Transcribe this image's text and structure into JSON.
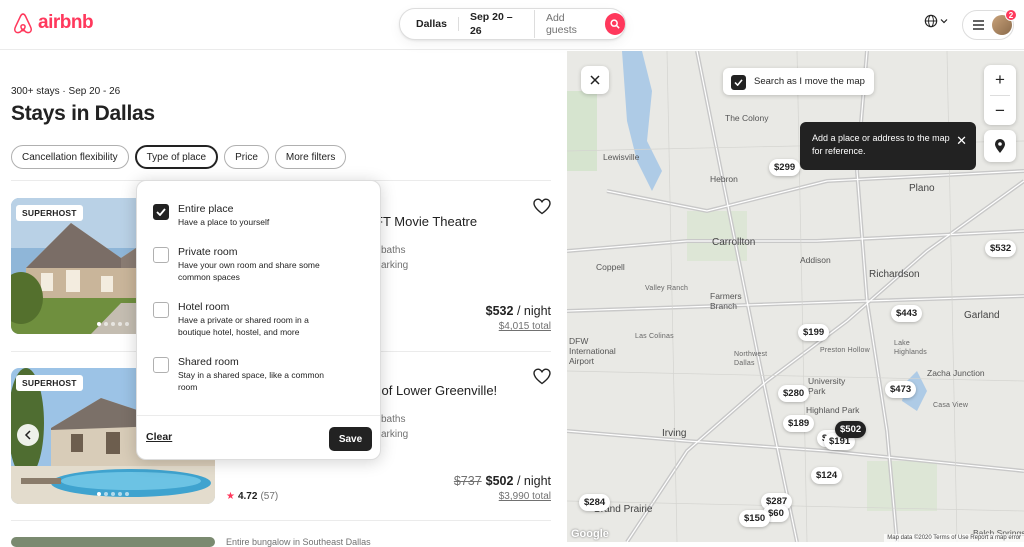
{
  "header": {
    "logo_text": "airbnb",
    "brand_color": "#ff385c",
    "search": {
      "location": "Dallas",
      "dates": "Sep 20 – 26",
      "guests_placeholder": "Add guests"
    },
    "notification_count": "2"
  },
  "listing": {
    "summary": "300+ stays · Sep 20 - 26",
    "title": "Stays in Dallas",
    "filters": [
      "Cancellation flexibility",
      "Type of place",
      "Price",
      "More filters"
    ]
  },
  "cards": [
    {
      "badge": "SUPERHOST",
      "title_partial": "FT Movie Theatre",
      "sub1": "baths",
      "sub2": "arking",
      "price": "$532",
      "per": " / night",
      "total": "$4,015 total"
    },
    {
      "badge": "SUPERHOST",
      "title_partial": "rt of Lower Greenville!",
      "sub1": "baths",
      "sub2": "arking",
      "old_price": "$737",
      "price": "$502",
      "per": " / night",
      "total": "$3,990 total",
      "rating": "4.72",
      "reviews": "(57)"
    },
    {
      "title_partial": "Entire bungalow in Southeast Dallas"
    }
  ],
  "type_of_place": {
    "options": [
      {
        "title": "Entire place",
        "desc": "Have a place to yourself",
        "checked": true
      },
      {
        "title": "Private room",
        "desc": "Have your own room and share some common spaces",
        "checked": false
      },
      {
        "title": "Hotel room",
        "desc": "Have a private or shared room in a boutique hotel, hostel, and more",
        "checked": false
      },
      {
        "title": "Shared room",
        "desc": "Stay in a shared space, like a common room",
        "checked": false
      }
    ],
    "clear_label": "Clear",
    "save_label": "Save"
  },
  "map": {
    "search_as_move": "Search as I move the map",
    "tooltip": "Add a place or address to the map for reference.",
    "zoom_in": "+",
    "zoom_out": "−",
    "pins": [
      "$299",
      "$532",
      "$443",
      "$199",
      "$473",
      "$280",
      "$502",
      "$189",
      "$191",
      "$76",
      "$124",
      "$287",
      "$60",
      "$150",
      "$284"
    ],
    "places": [
      "The Colony",
      "Lewisville",
      "Hebron",
      "Plano",
      "Carrollton",
      "Coppell",
      "Farmers Branch",
      "Richardson",
      "Garland",
      "Addison",
      "Irving",
      "University Park",
      "Highland Park",
      "DFW International Airport",
      "Grand Prairie",
      "Balch Springs",
      "Zacha Junction",
      "Casa View",
      "Preston Hollow",
      "Northwest Dallas",
      "Lake Highlands",
      "Las Colinas",
      "Valley Ranch"
    ],
    "google": "Google",
    "credit": "Map data ©2020  Terms of Use  Report a map error"
  }
}
